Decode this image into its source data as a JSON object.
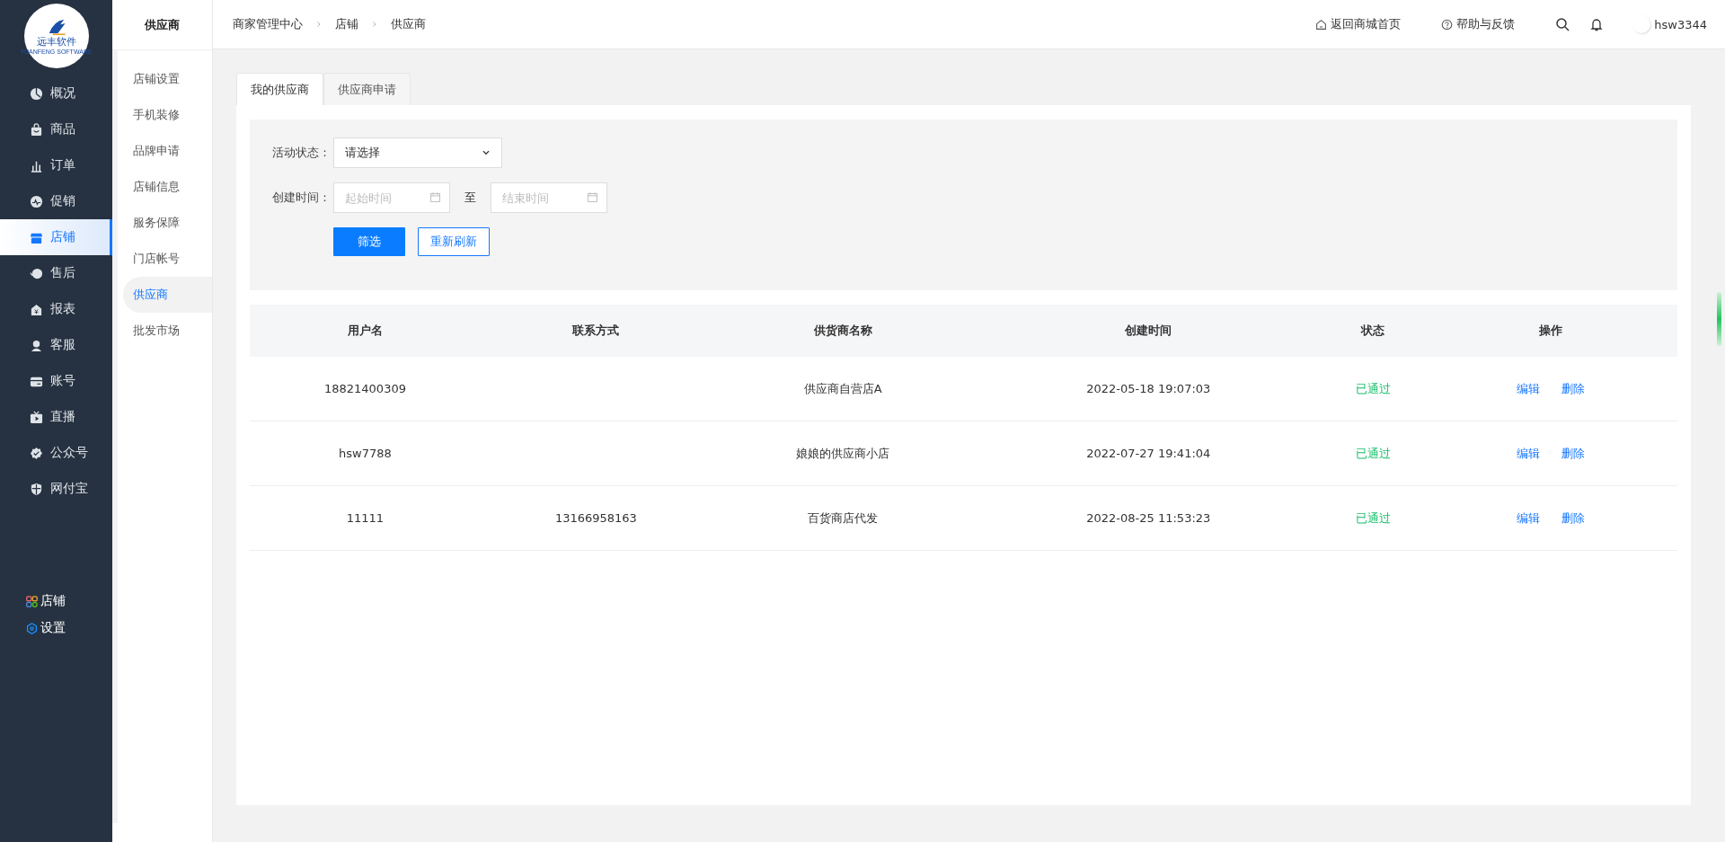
{
  "logo": {
    "text": "远丰软件",
    "subtext": "YUANFENG SOFTWARE"
  },
  "sidebar": {
    "items": [
      {
        "label": "概况",
        "selected": false
      },
      {
        "label": "商品",
        "selected": false
      },
      {
        "label": "订单",
        "selected": false
      },
      {
        "label": "促销",
        "selected": false
      },
      {
        "label": "店铺",
        "selected": true
      },
      {
        "label": "售后",
        "selected": false
      },
      {
        "label": "报表",
        "selected": false
      },
      {
        "label": "客服",
        "selected": false
      },
      {
        "label": "账号",
        "selected": false
      },
      {
        "label": "直播",
        "selected": false
      },
      {
        "label": "公众号",
        "selected": false
      },
      {
        "label": "网付宝",
        "selected": false
      }
    ],
    "bottom_items": [
      {
        "label": "店铺"
      },
      {
        "label": "设置"
      }
    ]
  },
  "subnav": {
    "title": "供应商",
    "items": [
      {
        "label": "店铺设置",
        "selected": false
      },
      {
        "label": "手机装修",
        "selected": false
      },
      {
        "label": "品牌申请",
        "selected": false
      },
      {
        "label": "店铺信息",
        "selected": false
      },
      {
        "label": "服务保障",
        "selected": false
      },
      {
        "label": "门店帐号",
        "selected": false
      },
      {
        "label": "供应商",
        "selected": true
      },
      {
        "label": "批发市场",
        "selected": false
      }
    ]
  },
  "breadcrumb": [
    "商家管理中心",
    "店铺",
    "供应商"
  ],
  "header": {
    "home_link": "返回商城首页",
    "help_link": "帮助与反馈",
    "username": "hsw3344"
  },
  "tabs": [
    {
      "label": "我的供应商",
      "selected": true
    },
    {
      "label": "供应商申请",
      "selected": false
    }
  ],
  "filters": {
    "status_label": "活动状态：",
    "status_value": "请选择",
    "time_label": "创建时间：",
    "start_placeholder": "起始时间",
    "to": "至",
    "end_placeholder": "结束时间",
    "filter_button": "筛选",
    "reset_button": "重新刷新"
  },
  "table": {
    "columns": [
      "用户名",
      "联系方式",
      "供货商名称",
      "创建时间",
      "状态",
      "操作"
    ],
    "rows": [
      {
        "username": "18821400309",
        "contact": "",
        "name": "供应商自营店A",
        "created": "2022-05-18 19:07:03",
        "status": "已通过",
        "actions": [
          "编辑",
          "删除"
        ]
      },
      {
        "username": "hsw7788",
        "contact": "",
        "name": "娘娘的供应商小店",
        "created": "2022-07-27 19:41:04",
        "status": "已通过",
        "actions": [
          "编辑",
          "删除"
        ]
      },
      {
        "username": "11111",
        "contact": "13166958163",
        "name": "百货商店代发",
        "created": "2022-08-25 11:53:23",
        "status": "已通过",
        "actions": [
          "编辑",
          "删除"
        ]
      }
    ]
  }
}
